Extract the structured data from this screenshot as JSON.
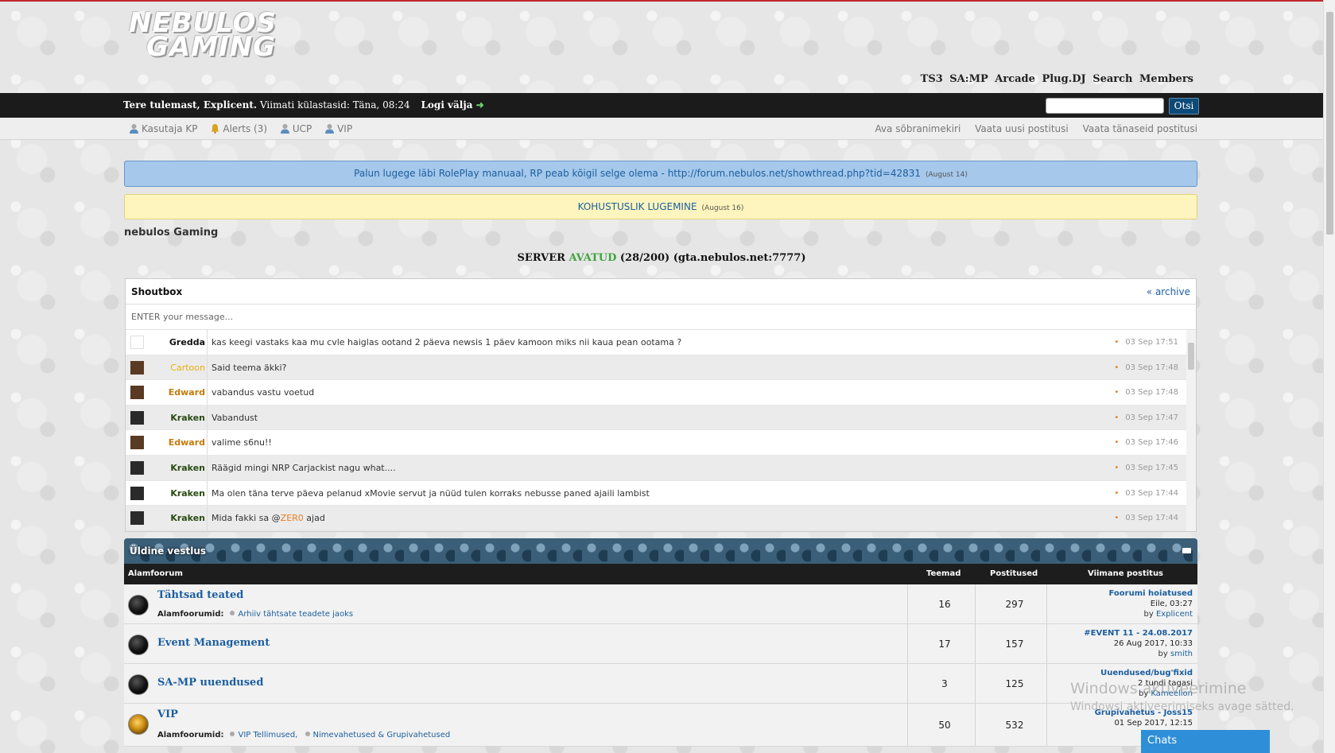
{
  "header": {
    "logo_line1": "NEBULOS",
    "logo_line2": "GAMING",
    "toplinks": [
      "TS3",
      "SA:MP",
      "Arcade",
      "Plug.DJ",
      "Search",
      "Members"
    ]
  },
  "welcome": {
    "greeting": "Tere tulemast, Explicent.",
    "last_visit": "Viimati külastasid: Täna, 08:24",
    "logout": "Logi välja",
    "search_placeholder": "",
    "search_button": "Otsi"
  },
  "subnav": {
    "left": [
      "Kasutaja KP",
      "Alerts (3)",
      "UCP",
      "VIP"
    ],
    "right": [
      "Ava sõbranimekiri",
      "Vaata uusi postitusi",
      "Vaata tänaseid postitusi"
    ]
  },
  "announcements": [
    {
      "text": "Palun lugege läbi RolePlay manuaal, RP peab kõigil selge olema - http://forum.nebulos.net/showthread.php?tid=42831",
      "date": "(August 14)"
    },
    {
      "text": "KOHUSTUSLIK LUGEMINE",
      "date": "(August 16)"
    }
  ],
  "site_name": "nebulos Gaming",
  "server": {
    "prefix": "SERVER",
    "status": "AVATUD",
    "suffix": "(28/200) (gta.nebulos.net:7777)"
  },
  "shoutbox": {
    "title": "Shoutbox",
    "archive": "« archive",
    "input_placeholder": "ENTER your message...",
    "rows": [
      {
        "user": "Gredda",
        "message": "kas keegi vastaks kaa mu cvle haiglas ootand 2 päeva newsis 1 päev kamoon miks nii kaua pean ootama ?",
        "time": "03 Sep 17:51"
      },
      {
        "user": "Cartoon",
        "message": "Said teema äkki?",
        "time": "03 Sep 17:48"
      },
      {
        "user": "Edward",
        "message": "vabandus vastu voetud",
        "time": "03 Sep 17:48"
      },
      {
        "user": "Kraken",
        "message": "Vabandust",
        "time": "03 Sep 17:47"
      },
      {
        "user": "Edward",
        "message": "valime s6nu!!",
        "time": "03 Sep 17:46"
      },
      {
        "user": "Kraken",
        "message": "Räägid mingi NRP Carjackist nagu what....",
        "time": "03 Sep 17:45"
      },
      {
        "user": "Kraken",
        "message": "Ma olen täna terve päeva pelanud xMovie servut ja nüüd tulen korraks nebusse paned ajaili lambist",
        "time": "03 Sep 17:44"
      },
      {
        "user": "Kraken",
        "message_pre": "Mida fakki sa @",
        "mention": "ZER0",
        "message_post": " ajad",
        "time": "03 Sep 17:44"
      }
    ]
  },
  "forum": {
    "title": "Üldine vestlus",
    "columns": {
      "sub": "Alamfoorum",
      "topics": "Teemad",
      "posts": "Postitused",
      "last": "Viimane postitus"
    },
    "subforums_label": "Alamfoorumid:",
    "rows": [
      {
        "name": "Tähtsad teated",
        "subforums": [
          "Arhiiv tähtsate teadete jaoks"
        ],
        "topics": "16",
        "posts": "297",
        "last_title": "Foorumi hoiatused",
        "last_date": "Eile, 03:27",
        "last_by": "by",
        "last_user": "Explicent"
      },
      {
        "name": "Event Management",
        "subforums": [],
        "topics": "17",
        "posts": "157",
        "last_title": "#EVENT 11 - 24.08.2017",
        "last_date": "26 Aug 2017, 10:33",
        "last_by": "by",
        "last_user": "smith"
      },
      {
        "name": "SA-MP uuendused",
        "subforums": [],
        "topics": "3",
        "posts": "125",
        "last_title": "Uuendused/bug'fixid",
        "last_date": "2 tundi tagasi",
        "last_by": "by",
        "last_user": "Kameelion"
      },
      {
        "name": "VIP",
        "subforums": [
          "VIP Tellimused,",
          "Nimevahetused & Grupivahetused"
        ],
        "topics": "50",
        "posts": "532",
        "last_title": "Grupivahetus - Joss15",
        "last_date": "01 Sep 2017, 12:15",
        "last_by": "",
        "last_user": ""
      }
    ]
  },
  "watermark": {
    "line1": "Windows aktiveerimine",
    "line2": "Windowsi aktiveerimiseks avage sätted."
  },
  "chats_label": "Chats",
  "colors": {
    "accent": "#1b5e9f",
    "server_ok": "#3fa33f",
    "chat_blue": "#2e8fd8",
    "black_bar": "#1b1b1b"
  }
}
